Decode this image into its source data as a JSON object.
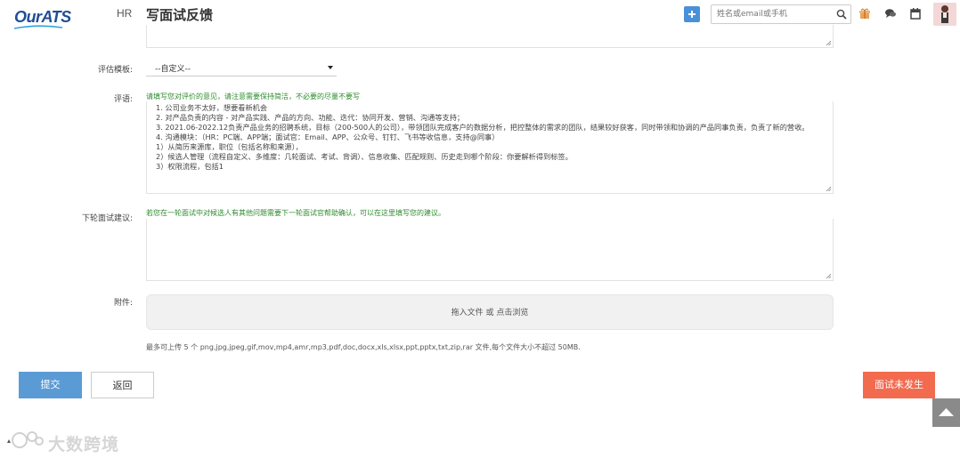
{
  "header": {
    "logo_text": "OurATS",
    "nav_label": "HR",
    "title": "写面试反馈",
    "search_placeholder": "姓名或email或手机",
    "icons": [
      "plus-icon",
      "search-icon",
      "gift-icon",
      "chat-icon",
      "calendar-icon",
      "avatar"
    ]
  },
  "form": {
    "template_label": "评估模板:",
    "template_value": "--自定义--",
    "review_label": "评语:",
    "review_hint": "请填写您对评价的意见，请注意需要保持简洁，不必要的尽量不要写",
    "review_lines": [
      "1. 公司业务不太好，想要看新机会",
      "2. 对产品负责的内容 - 对产品实践、产品的方向、功能、迭代：协同开发、营销、沟通等支持；",
      "3. 2021.06-2022.12负责产品业务的招聘系统，目标（200-500人的公司），带领团队完成客户的数据分析，把控整体的需求的团队，结果较好获客，同时带领和协调的产品同事负责，负责了新的营收。",
      "4. 沟通模块：（HR：PC端、APP端；面试官：Email、APP、公众号、钉钉、飞书等收信息，支持@同事）",
      "1）从简历来源库，职位（包括名称和来源），",
      "2）候选人管理（流程自定义、多维度：几轮面试、考试、背调）、信息收集、匹配规则、历史走到哪个阶段：你要解析得到标签。",
      "3）权限流程，包括1"
    ],
    "suggest_label": "下轮面试建议:",
    "suggest_hint": "若您在一轮面试中对候选人有其他问题需要下一轮面试官帮助确认，可以在这里填写您的建议。",
    "attachment_label": "附件:",
    "dropzone_text": "拖入文件 或 点击浏览",
    "upload_note": "最多可上传 5 个 png,jpg,jpeg,gif,mov,mp4,amr,mp3,pdf,doc,docx,xls,xlsx,ppt,pptx,txt,zip,rar 文件,每个文件大小不超过 50MB."
  },
  "actions": {
    "submit_label": "提交",
    "back_label": "返回",
    "unsent_label": "面试未发生"
  },
  "watermark": {
    "text": "大数跨境"
  },
  "colors": {
    "brand": "#1f4e96",
    "submit": "#5b9bd5",
    "unsent": "#f26b4f",
    "hint_green": "#2e8b2e"
  }
}
